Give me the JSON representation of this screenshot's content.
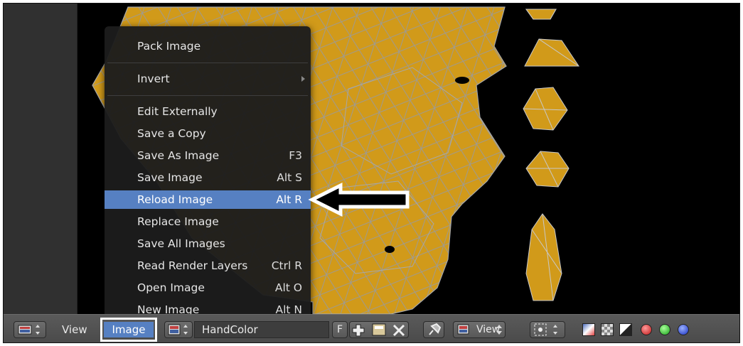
{
  "menu": {
    "items": [
      {
        "label": "Pack Image",
        "shortcut": ""
      },
      {
        "label": "Invert",
        "shortcut": "",
        "submenu": true
      },
      {
        "label": "Edit Externally",
        "shortcut": ""
      },
      {
        "label": "Save a Copy",
        "shortcut": ""
      },
      {
        "label": "Save As Image",
        "shortcut": "F3"
      },
      {
        "label": "Save Image",
        "shortcut": "Alt S"
      },
      {
        "label": "Reload Image",
        "shortcut": "Alt R",
        "highlighted": true
      },
      {
        "label": "Replace Image",
        "shortcut": ""
      },
      {
        "label": "Save All Images",
        "shortcut": ""
      },
      {
        "label": "Read Render Layers",
        "shortcut": "Ctrl R"
      },
      {
        "label": "Open Image",
        "shortcut": "Alt O"
      },
      {
        "label": "New Image",
        "shortcut": "Alt N"
      }
    ]
  },
  "header": {
    "view_menu": "View",
    "image_menu": "Image",
    "image_name": "HandColor",
    "fake_user": "F",
    "view_mode": "View"
  },
  "colors": {
    "accent": "#5680c2",
    "uv_fill": "#d19a1a",
    "uv_wire": "#9a9a9a"
  },
  "icons": [
    "editor-type-icon",
    "image-browse-icon",
    "new-image-icon",
    "open-image-icon",
    "unlink-icon",
    "pin-icon",
    "pivot-icon",
    "channel-rgb-alpha-icon",
    "channel-alpha-icon",
    "channel-z-icon",
    "channel-red-icon",
    "channel-green-icon",
    "channel-blue-icon"
  ]
}
